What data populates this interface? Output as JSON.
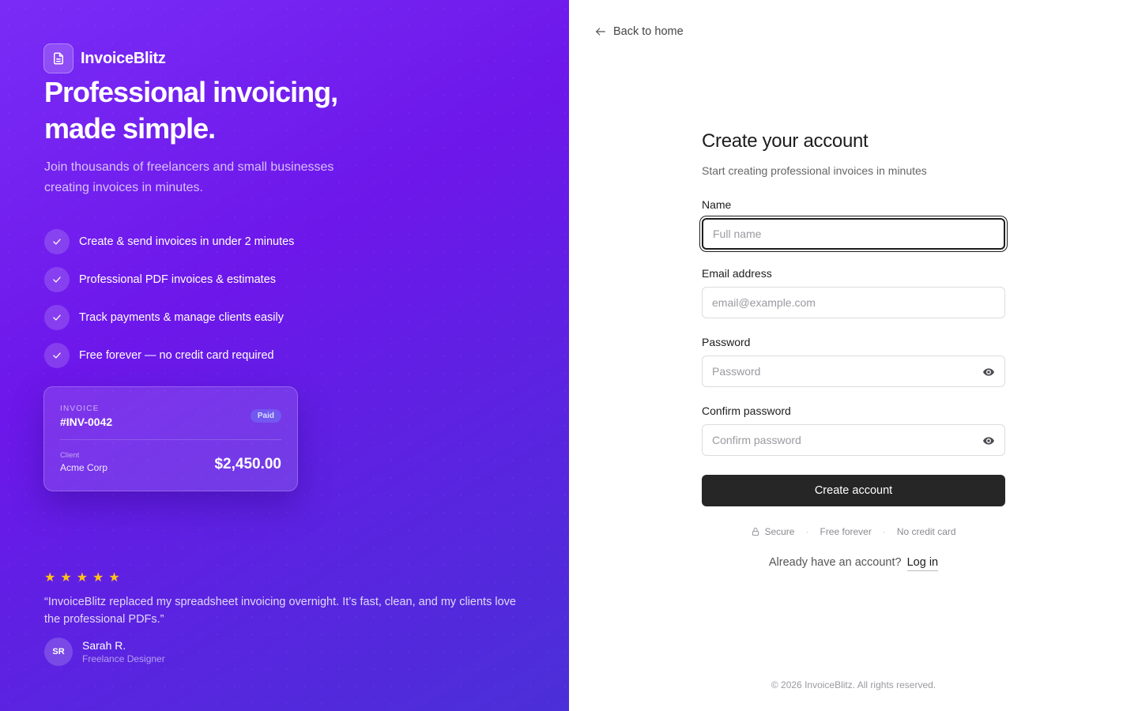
{
  "brand": {
    "name": "InvoiceBlitz",
    "logo_icon": "document-icon"
  },
  "hero": {
    "headline": "Professional invoicing, made simple.",
    "subtitle": "Join thousands of freelancers and small businesses creating invoices in minutes."
  },
  "features": [
    "Create & send invoices in under 2 minutes",
    "Professional PDF invoices & estimates",
    "Track payments & manage clients easily",
    "Free forever — no credit card required"
  ],
  "invoice_card": {
    "kicker": "INVOICE",
    "number": "#INV-0042",
    "status": "Paid",
    "client_label": "Client",
    "client_name": "Acme Corp",
    "amount": "$2,450.00"
  },
  "testimonial": {
    "rating": 5,
    "quote": "“InvoiceBlitz replaced my spreadsheet invoicing overnight. It’s fast, clean, and my clients love the professional PDFs.”",
    "initials": "SR",
    "name": "Sarah R.",
    "role": "Freelance Designer"
  },
  "nav": {
    "back_label": "Back to home"
  },
  "form": {
    "title": "Create your account",
    "subtitle": "Start creating professional invoices in minutes",
    "name": {
      "label": "Name",
      "placeholder": "Full name",
      "value": ""
    },
    "email": {
      "label": "Email address",
      "placeholder": "email@example.com",
      "value": ""
    },
    "password": {
      "label": "Password",
      "placeholder": "Password",
      "value": ""
    },
    "confirm": {
      "label": "Confirm password",
      "placeholder": "Confirm password",
      "value": ""
    },
    "submit_label": "Create account"
  },
  "trust": {
    "secure": "Secure",
    "free": "Free forever",
    "no_card": "No credit card",
    "separator": "·"
  },
  "login": {
    "prompt": "Already have an account?",
    "link": "Log in"
  },
  "footer": "© 2026 InvoiceBlitz. All rights reserved.",
  "colors": {
    "accent_start": "#7a2cf6",
    "accent_end": "#4b2fd8",
    "button": "#262626",
    "star": "#ffc21a"
  }
}
